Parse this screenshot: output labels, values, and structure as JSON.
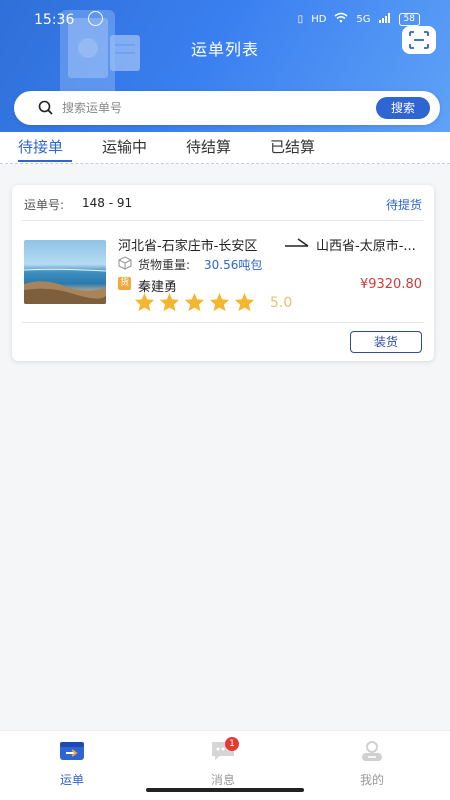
{
  "status_bar": {
    "time": "15:36",
    "hd": "HD",
    "network": "5G",
    "battery": "58"
  },
  "header": {
    "title": "运单列表",
    "scan_icon": "scan-icon"
  },
  "search": {
    "placeholder": "搜索运单号",
    "button_label": "搜索"
  },
  "tabs": [
    {
      "label": "待接单",
      "active": true
    },
    {
      "label": "运输中",
      "active": false
    },
    {
      "label": "待结算",
      "active": false
    },
    {
      "label": "已结算",
      "active": false
    }
  ],
  "orders": [
    {
      "order_label": "运单号:",
      "order_no": "148 - 91",
      "status": "待提货",
      "from": "河北省-石家庄市-长安区",
      "to": "山西省-太原市-...",
      "weight_label": "货物重量:",
      "weight_value": "30.56吨包",
      "driver_badge": "货",
      "driver_name": "秦建勇",
      "price": "¥9320.80",
      "rating": "5.0",
      "stars": 5,
      "action_label": "装货"
    }
  ],
  "bottom_nav": [
    {
      "label": "运单",
      "icon": "waybill-icon",
      "active": true
    },
    {
      "label": "消息",
      "icon": "message-icon",
      "active": false,
      "badge": "1"
    },
    {
      "label": "我的",
      "icon": "profile-icon",
      "active": false
    }
  ],
  "colors": {
    "primary": "#2f64d3",
    "price": "#d03a3a",
    "star": "#f5b52e"
  }
}
